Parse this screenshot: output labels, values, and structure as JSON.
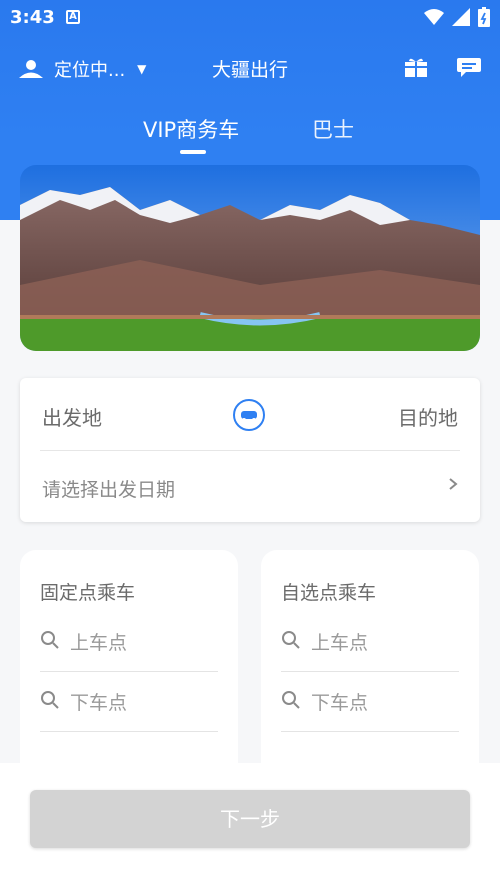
{
  "status_bar": {
    "time": "3:43",
    "icons": [
      "a-notification-icon",
      "wifi-icon",
      "cell-signal-icon",
      "battery-icon"
    ]
  },
  "header": {
    "location_label": "定位中...",
    "title": "大疆出行",
    "icons": [
      "user-icon",
      "gift-icon",
      "message-icon"
    ]
  },
  "tabs": [
    {
      "label": "VIP商务车",
      "active": true
    },
    {
      "label": "巴士",
      "active": false
    }
  ],
  "route": {
    "from_label": "出发地",
    "to_label": "目的地",
    "date_placeholder": "请选择出发日期"
  },
  "pickup_cards": [
    {
      "title": "固定点乘车",
      "boarding_placeholder": "上车点",
      "alighting_placeholder": "下车点"
    },
    {
      "title": "自选点乘车",
      "boarding_placeholder": "上车点",
      "alighting_placeholder": "下车点"
    }
  ],
  "footer": {
    "next_label": "下一步"
  },
  "colors": {
    "brand_blue": "#2f80f2",
    "button_disabled": "#d3d3d3"
  }
}
